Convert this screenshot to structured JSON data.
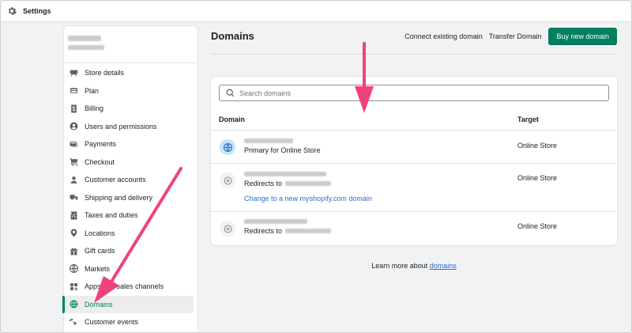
{
  "topbar": {
    "title": "Settings",
    "icon": "gear-icon"
  },
  "sidebar": {
    "items": [
      {
        "label": "Store details",
        "icon": "store-icon"
      },
      {
        "label": "Plan",
        "icon": "plan-icon"
      },
      {
        "label": "Billing",
        "icon": "billing-icon"
      },
      {
        "label": "Users and permissions",
        "icon": "user-circle-icon"
      },
      {
        "label": "Payments",
        "icon": "payments-icon"
      },
      {
        "label": "Checkout",
        "icon": "cart-icon"
      },
      {
        "label": "Customer accounts",
        "icon": "person-icon"
      },
      {
        "label": "Shipping and delivery",
        "icon": "truck-icon"
      },
      {
        "label": "Taxes and duties",
        "icon": "tax-icon"
      },
      {
        "label": "Locations",
        "icon": "location-pin-icon"
      },
      {
        "label": "Gift cards",
        "icon": "gift-icon"
      },
      {
        "label": "Markets",
        "icon": "globe-icon"
      },
      {
        "label": "Apps and sales channels",
        "icon": "apps-icon"
      },
      {
        "label": "Domains",
        "icon": "domains-globe-icon",
        "active": true
      },
      {
        "label": "Customer events",
        "icon": "cursor-sparkle-icon"
      }
    ]
  },
  "main": {
    "title": "Domains",
    "actions": {
      "connect_label": "Connect existing domain",
      "transfer_label": "Transfer Domain",
      "buy_label": "Buy new domain"
    },
    "search": {
      "placeholder": "Search domains"
    },
    "table": {
      "col_domain": "Domain",
      "col_target": "Target",
      "rows": [
        {
          "status": "primary",
          "sub_label": "Primary for Online Store",
          "target": "Online Store"
        },
        {
          "status": "redirect",
          "sub_label": "Redirects to",
          "link": "Change to a new myshopify.com domain",
          "target": "Online Store"
        },
        {
          "status": "redirect",
          "sub_label": "Redirects to",
          "target": "Online Store"
        }
      ]
    },
    "learn_more": {
      "prefix": "Learn more about",
      "link": "domains"
    }
  },
  "colors": {
    "accent": "#008060",
    "link": "#2c6ecb",
    "annotation_arrow": "#f0427a"
  }
}
